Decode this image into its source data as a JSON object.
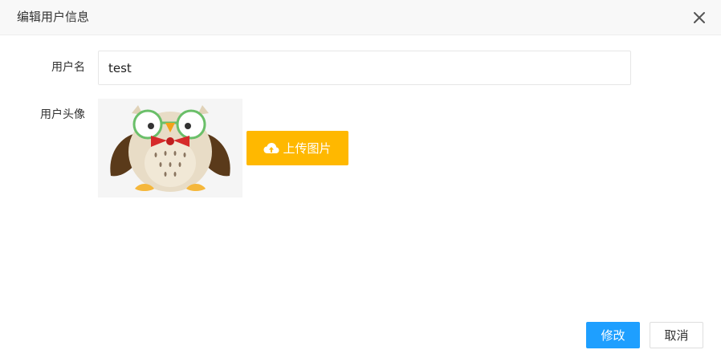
{
  "dialog": {
    "title": "编辑用户信息",
    "close_icon": "close-icon"
  },
  "form": {
    "username_label": "用户名",
    "username_value": "test",
    "avatar_label": "用户头像",
    "avatar_image": "owl-avatar-image",
    "upload_label": "上传图片",
    "upload_icon": "cloud-upload-icon",
    "upload_color": "#ffb800"
  },
  "footer": {
    "submit_label": "修改",
    "submit_color": "#1e9fff",
    "cancel_label": "取消"
  }
}
